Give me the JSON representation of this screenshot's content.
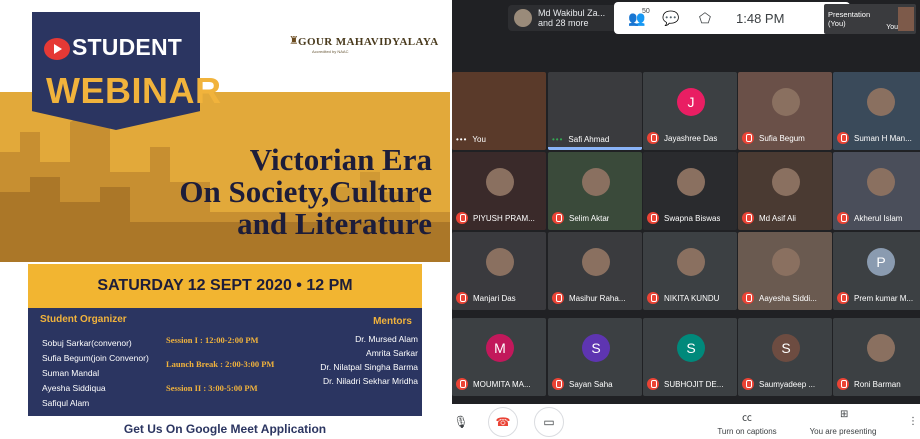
{
  "poster": {
    "badge_student": "STUDENT",
    "badge_webinar": "WEBINAR",
    "college_name": "GOUR MAHAVIDYALAYA",
    "college_sub": "Accredited by NAAC",
    "title_lines": [
      "Victorian Era",
      "On Society,Culture",
      "and Literature"
    ],
    "date": "SATURDAY  12 SEPT 2020 • 12 PM",
    "organizer_heading": "Student Organizer",
    "organizers": [
      "Sobuj Sarkar(convenor)",
      "Sufia Begum(join Convenor)",
      "Suman Mandal",
      "Ayesha Siddiqua",
      "Safiqul Alam"
    ],
    "sessions": [
      "Session I : 12:00-2:00 PM",
      "Launch Break : 2:00-3:00 PM",
      "Session II : 3:00-5:00 PM"
    ],
    "mentor_heading": "Mentors",
    "mentors": [
      "Dr. Mursed Alam",
      "Amrita Sarkar",
      "Dr. Nilatpal Singha Barma",
      "Dr. Niladri Sekhar Mridha"
    ],
    "cta": "Get Us On Google Meet Application",
    "colors": {
      "navy": "#2b3561",
      "gold": "#f2b531"
    }
  },
  "meet": {
    "host_line1": "Md Wakibul Za...",
    "host_line2": "and 28 more",
    "people_count": "50",
    "time": "1:48 PM",
    "presentation_label": "Presentation\n(You)",
    "presentation_you": "You",
    "tiles": [
      {
        "name": "You",
        "kind": "photo",
        "indicator": "dots"
      },
      {
        "name": "Safi Ahmad",
        "kind": "photo",
        "indicator": "dots-green",
        "speaking": true
      },
      {
        "name": "Jayashree Das",
        "kind": "avatar",
        "letter": "J",
        "color": "#e91e63",
        "indicator": "mute"
      },
      {
        "name": "Sufia Begum",
        "kind": "photo",
        "indicator": "mute"
      },
      {
        "name": "Suman H Man...",
        "kind": "photo",
        "indicator": "mute"
      },
      {
        "name": "PIYUSH PRAM...",
        "kind": "photo",
        "indicator": "mute"
      },
      {
        "name": "Selim Aktar",
        "kind": "photo",
        "indicator": "mute"
      },
      {
        "name": "Swapna Biswas",
        "kind": "photo",
        "indicator": "mute"
      },
      {
        "name": "Md Asif Ali",
        "kind": "photo",
        "indicator": "mute"
      },
      {
        "name": "Akherul Islam",
        "kind": "photo",
        "indicator": "mute"
      },
      {
        "name": "Manjari Das",
        "kind": "photo",
        "indicator": "mute"
      },
      {
        "name": "Masihur Raha...",
        "kind": "photo",
        "indicator": "mute"
      },
      {
        "name": "NIKITA KUNDU",
        "kind": "photo",
        "indicator": "mute"
      },
      {
        "name": "Aayesha Siddi...",
        "kind": "photo",
        "indicator": "mute"
      },
      {
        "name": "Prem kumar M...",
        "kind": "avatar",
        "letter": "P",
        "color": "#8a9bb0",
        "indicator": "mute"
      },
      {
        "name": "MOUMITA MA...",
        "kind": "avatar",
        "letter": "M",
        "color": "#c2185b",
        "indicator": "mute"
      },
      {
        "name": "Sayan Saha",
        "kind": "avatar",
        "letter": "S",
        "color": "#5e35b1",
        "indicator": "mute"
      },
      {
        "name": "SUBHOJIT DE...",
        "kind": "avatar",
        "letter": "S",
        "color": "#00897b",
        "indicator": "mute"
      },
      {
        "name": "Saumyadeep ...",
        "kind": "avatar",
        "letter": "S",
        "color": "#6d4c41",
        "indicator": "mute"
      },
      {
        "name": "Roni Barman",
        "kind": "photo",
        "indicator": "mute"
      }
    ],
    "captions_label": "Turn on captions",
    "presenting_label": "You are presenting"
  }
}
